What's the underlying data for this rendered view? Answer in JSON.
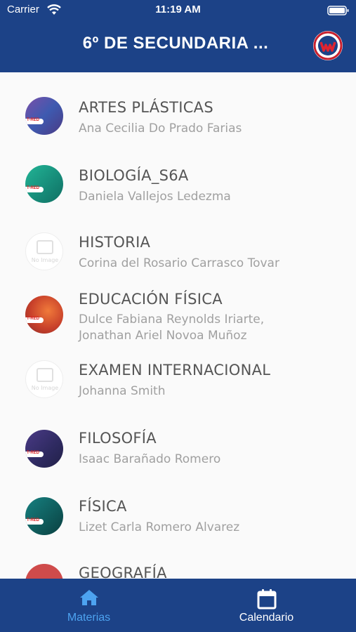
{
  "status_bar": {
    "carrier": "Carrier",
    "time": "11:19 AM"
  },
  "header": {
    "title": "6º DE SECUNDARIA ..."
  },
  "courses": [
    {
      "title": "ARTES PLÁSTICAS",
      "teacher": "Ana Cecilia Do Prado Farias",
      "image": "course-cover",
      "color": "#5b3f86"
    },
    {
      "title": "BIOLOGÍA_S6A",
      "teacher": "Daniela Vallejos Ledezma",
      "image": "course-cover",
      "color": "#1c9b84"
    },
    {
      "title": "HISTORIA",
      "teacher": "Corina del Rosario Carrasco Tovar",
      "image": "no-image",
      "no_image_text": "No Image"
    },
    {
      "title": "EDUCACIÓN FÍSICA",
      "teacher": "Dulce Fabiana Reynolds Iriarte,",
      "teacher_line2": "Jonathan Ariel Novoa Muñoz",
      "image": "course-cover",
      "color": "#d4502a"
    },
    {
      "title": "EXAMEN INTERNACIONAL",
      "teacher": "Johanna Smith",
      "image": "no-image",
      "no_image_text": "No Image"
    },
    {
      "title": "FILOSOFÍA",
      "teacher": "Isaac Barañado Romero",
      "image": "course-cover",
      "color": "#3b2f6e"
    },
    {
      "title": "FÍSICA",
      "teacher": "Lizet Carla Romero Alvarez",
      "image": "course-cover",
      "color": "#12605e"
    },
    {
      "title": "GEOGRAFÍA",
      "teacher": "",
      "image": "course-cover",
      "color": "#cf4b4b"
    }
  ],
  "tabs": [
    {
      "label": "Materias",
      "icon": "home-icon",
      "active": true
    },
    {
      "label": "Calendario",
      "icon": "calendar-icon",
      "active": false
    }
  ],
  "colors": {
    "primary": "#1c4287",
    "active_tab": "#4da3f0"
  }
}
